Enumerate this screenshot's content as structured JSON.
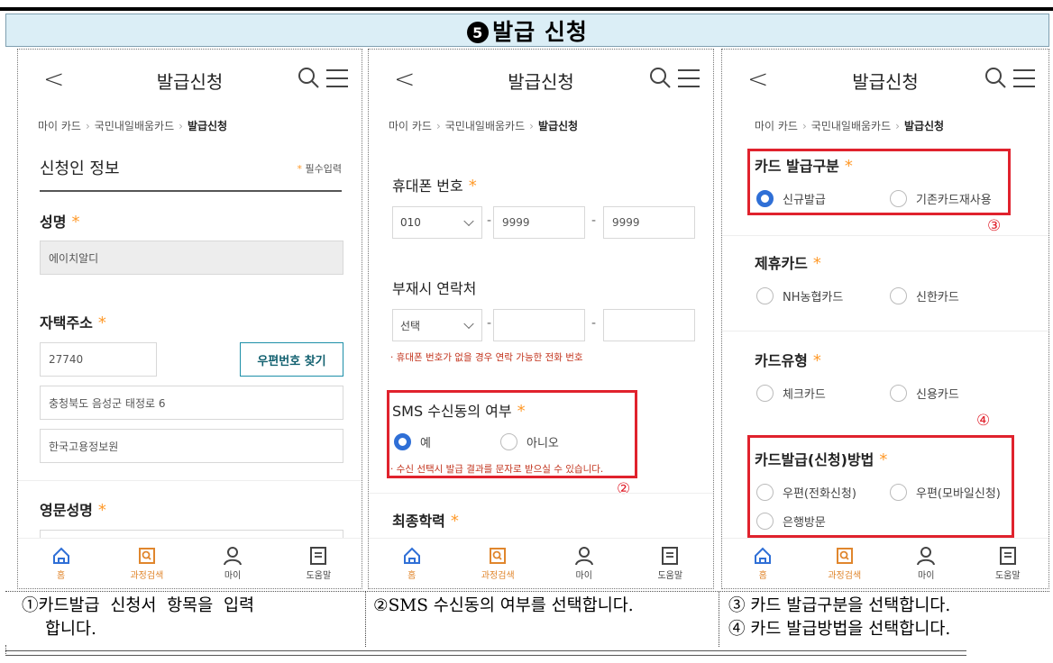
{
  "header": {
    "step_glyph": "5",
    "title": "발급 신청"
  },
  "common": {
    "page_title": "발급신청",
    "breadcrumb": [
      "마이 카드",
      "국민내일배움카드",
      "발급신청"
    ],
    "nav": [
      "홈",
      "과정검색",
      "마이",
      "도움말"
    ]
  },
  "panel1": {
    "section_title": "신청인 정보",
    "required_note": "* 필수입력",
    "name_label": "성명",
    "name_value": "에이치알디",
    "address_label": "자택주소",
    "zip_value": "27740",
    "zip_button": "우편번호 찾기",
    "address1": "충청북도 음성군 태정로 6",
    "address2": "한국고용정보원",
    "english_name_label": "영문성명"
  },
  "panel2": {
    "phone_label": "휴대폰 번호",
    "phone_prefix": "010",
    "phone_mid": "9999",
    "phone_last": "9999",
    "alt_label": "부재시 연락처",
    "alt_select": "선택",
    "alt_note": "· 휴대폰 번호가 없을 경우 연락 가능한 전화 번호",
    "sms_label": "SMS 수신동의 여부",
    "sms_yes": "예",
    "sms_no": "아니오",
    "sms_note": "· 수신 선택시 발급 결과를 문자로 받으실 수 있습니다.",
    "edu_label": "최종학력",
    "marker": "②"
  },
  "panel3": {
    "card_type_label": "카드 발급구분",
    "new_issue": "신규발급",
    "reuse": "기존카드재사용",
    "marker3": "③",
    "partner_label": "제휴카드",
    "nh": "NH농협카드",
    "shinhan": "신한카드",
    "kind_label": "카드유형",
    "check": "체크카드",
    "credit": "신용카드",
    "marker4": "④",
    "method_label": "카드발급(신청)방법",
    "post_phone": "우편(전화신청)",
    "post_mobile": "우편(모바일신청)",
    "bank": "은행방문"
  },
  "captions": {
    "c1_line1": "①카드발급  신청서  항목을  입력",
    "c1_line2": "합니다.",
    "c2": "②SMS 수신동의 여부를 선택합니다.",
    "c3_line1": "③ 카드 발급구분을 선택합니다.",
    "c3_line2": "④ 카드 발급방법을 선택합니다."
  }
}
